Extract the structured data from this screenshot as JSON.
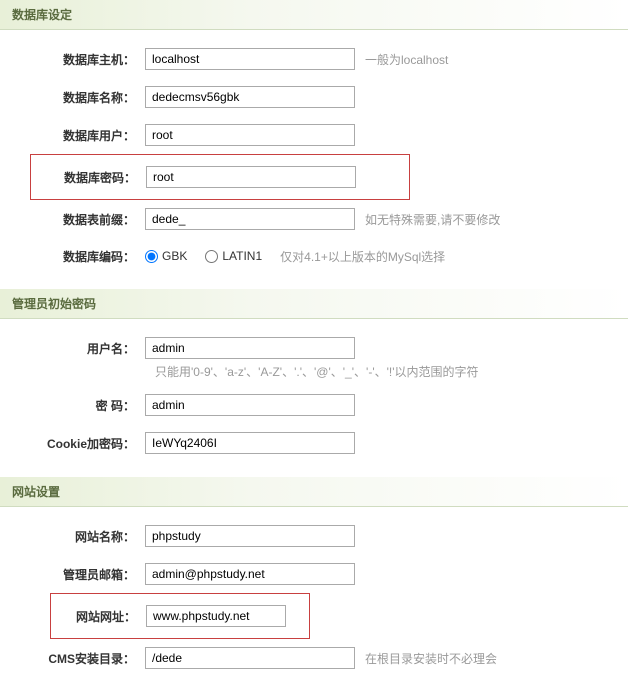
{
  "sections": {
    "database": {
      "title": "数据库设定",
      "host_label": "数据库主机：",
      "host_value": "localhost",
      "host_hint": "一般为localhost",
      "name_label": "数据库名称：",
      "name_value": "dedecmsv56gbk",
      "user_label": "数据库用户：",
      "user_value": "root",
      "password_label": "数据库密码：",
      "password_value": "root",
      "prefix_label": "数据表前缀：",
      "prefix_value": "dede_",
      "prefix_hint": "如无特殊需要,请不要修改",
      "encoding_label": "数据库编码：",
      "encoding_gbk": "GBK",
      "encoding_latin1": "LATIN1",
      "encoding_hint": "仅对4.1+以上版本的MySql选择"
    },
    "admin": {
      "title": "管理员初始密码",
      "username_label": "用户名：",
      "username_value": "admin",
      "username_hint": "只能用'0-9'、'a-z'、'A-Z'、'.'、'@'、'_'、'-'、'!'以内范围的字符",
      "password_label": "密  码：",
      "password_value": "admin",
      "cookie_label": "Cookie加密码：",
      "cookie_value": "IeWYq2406I"
    },
    "site": {
      "title": "网站设置",
      "name_label": "网站名称：",
      "name_value": "phpstudy",
      "email_label": "管理员邮箱：",
      "email_value": "admin@phpstudy.net",
      "url_label": "网站网址：",
      "url_value": "www.phpstudy.net",
      "install_label": "CMS安装目录：",
      "install_value": "/dede",
      "install_hint": "在根目录安装时不必理会"
    }
  }
}
